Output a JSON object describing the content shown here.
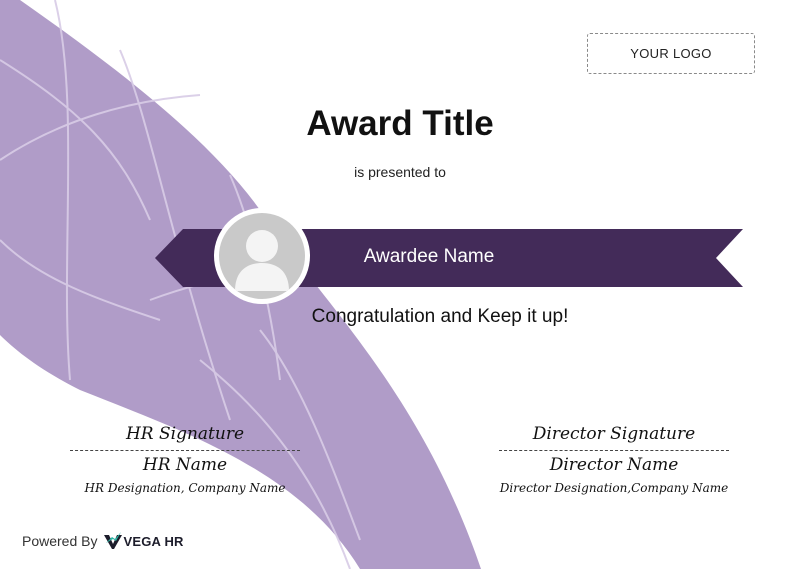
{
  "logo": {
    "text": "YOUR LOGO"
  },
  "certificate": {
    "title": "Award Title",
    "presented_text": "is presented to",
    "awardee_name": "Awardee Name",
    "message": "Congratulation and Keep it up!"
  },
  "signatures": {
    "left": {
      "label": "HR Signature",
      "name": "HR Name",
      "designation": "HR Designation, Company Name"
    },
    "right": {
      "label": "Director Signature",
      "name": "Director Name",
      "designation": "Director Designation,Company Name"
    }
  },
  "footer": {
    "powered_by": "Powered By",
    "brand": "VEGA HR"
  },
  "colors": {
    "swoosh": "#b09cc8",
    "ribbon": "#432b59",
    "avatar_bg": "#c9c9c9",
    "avatar_fg": "#f4f4f4",
    "brand_accent": "#2bb5a4"
  },
  "icons": {
    "avatar": "person-placeholder-icon",
    "brand": "vega-hr-logo-icon"
  }
}
